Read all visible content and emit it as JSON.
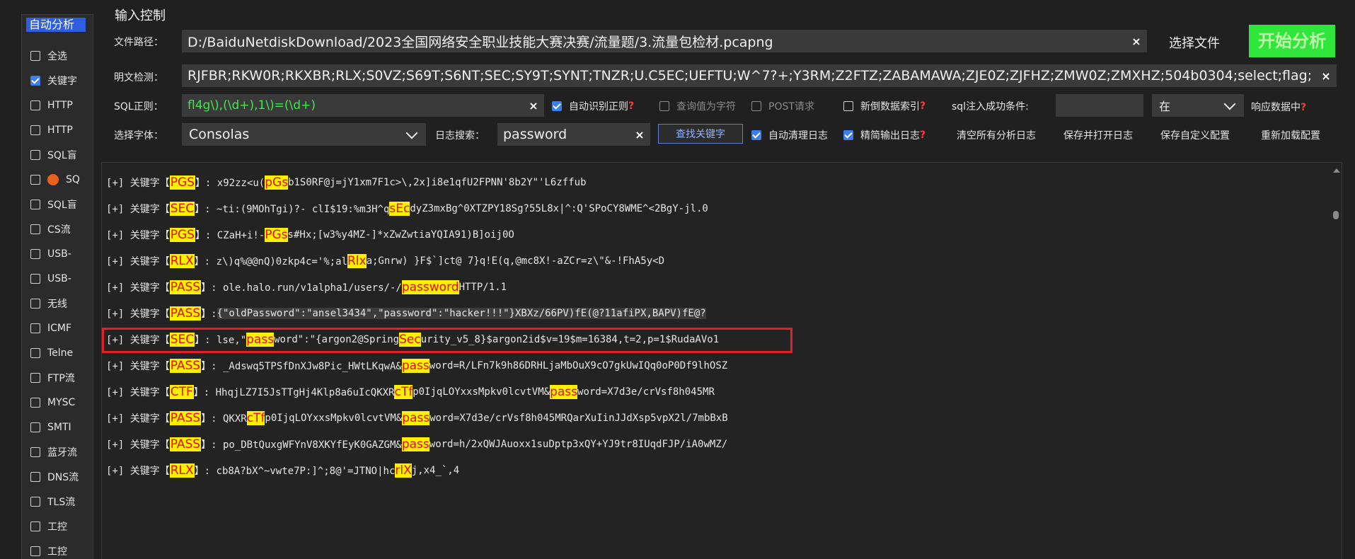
{
  "left_panel": {
    "header": "自动分析",
    "items": [
      {
        "label": "全选",
        "checked": false,
        "icon": null
      },
      {
        "label": "关键字",
        "checked": true,
        "icon": null
      },
      {
        "label": "HTTP",
        "checked": false,
        "icon": null
      },
      {
        "label": "HTTP",
        "checked": false,
        "icon": null
      },
      {
        "label": "SQL盲",
        "checked": false,
        "icon": null
      },
      {
        "label": "SQ",
        "checked": false,
        "icon": "orange-circle-icon"
      },
      {
        "label": "SQL盲",
        "checked": false,
        "icon": null
      },
      {
        "label": "CS流",
        "checked": false,
        "icon": null
      },
      {
        "label": "USB-",
        "checked": false,
        "icon": null
      },
      {
        "label": "USB-",
        "checked": false,
        "icon": null
      },
      {
        "label": "无线",
        "checked": false,
        "icon": null
      },
      {
        "label": "ICMF",
        "checked": false,
        "icon": null
      },
      {
        "label": "Telne",
        "checked": false,
        "icon": null
      },
      {
        "label": "FTP流",
        "checked": false,
        "icon": null
      },
      {
        "label": "MYSC",
        "checked": false,
        "icon": null
      },
      {
        "label": "SMTI",
        "checked": false,
        "icon": null
      },
      {
        "label": "蓝牙流",
        "checked": false,
        "icon": null
      },
      {
        "label": "DNS流",
        "checked": false,
        "icon": null
      },
      {
        "label": "TLS流",
        "checked": false,
        "icon": null
      },
      {
        "label": "工控",
        "checked": false,
        "icon": null
      },
      {
        "label": "工控",
        "checked": false,
        "icon": null
      }
    ]
  },
  "input_control": {
    "title": "输入控制",
    "file_path_label": "文件路径：",
    "file_path_value": "D:/BaiduNetdiskDownload/2023全国网络安全职业技能大赛决赛/流量题/3.流量包检材.pcapng",
    "select_file_label": "选择文件",
    "start_label": "开始分析",
    "plaintext_label": "明文检测：",
    "plaintext_value": ";RJFBR;RKW0R;RKXBR;RLX;S0VZ;S69T;S6NT;SEC;SY9T;SYNT;TNZR;U.C5EC;UEFTU;W^7?+;Y3RM;Z2FTZ;ZABAMAWA;ZJE0Z;ZJFHZ;ZMW0Z;ZMXHZ;504b0304;select;flag",
    "sql_regex_label": "SQL正则：",
    "sql_regex_value": "fl4g\\),(\\d+),1\\)=(\\d+)",
    "auto_regex_label": "自动识别正则",
    "query_as_char_label": "查询值为字符",
    "post_request_label": "POST请求",
    "new_index_label": "新倒数据索引",
    "sqli_success_label": "sql注入成功条件:",
    "sqli_success_value": "",
    "in_select_value": "在",
    "response_data_label": "响应数据中",
    "font_label": "选择字体：",
    "font_value": "Consolas",
    "log_search_label": "日志搜索：",
    "log_search_value": "password",
    "find_keyword_label": "查找关键字",
    "auto_clear_label": "自动清理日志",
    "simplified_output_label": "精简输出日志",
    "clear_all_label": "清空所有分析日志",
    "save_open_label": "保存并打开日志",
    "save_config_label": "保存自定义配置",
    "reload_config_label": "重新加载配置",
    "question_mark": "?",
    "close_x": "×"
  },
  "colors": {
    "accent_blue": "#2f5fe0",
    "start_green": "#31e63a",
    "highlight_yellow": "#ffef00",
    "highlight_red": "#e21010",
    "selection_red": "#e0202a"
  },
  "log_lines": [
    {
      "segs": [
        {
          "t": "[+] 关键字【"
        },
        {
          "t": "PGS",
          "k": 1
        },
        {
          "t": "】: x92zz<u("
        },
        {
          "t": "pGs",
          "h": 1
        },
        {
          "t": "b1S0RF@j=jY1xm7F1c>\\,2x]i8e1qfU2FPNN'8b2Y\"'L6zffub"
        }
      ]
    },
    {
      "segs": [
        {
          "t": "[+] 关键字【"
        },
        {
          "t": "SEC",
          "k": 1
        },
        {
          "t": "】: ~ti:(9MOhTgi)?- clI$19:%m3H^q"
        },
        {
          "t": "sEc",
          "h": 1
        },
        {
          "t": "dyZ3mxBg^0XTZPY18Sg?55L8x|^:Q'SPoCY8WME^<2BgY-jl.0"
        }
      ]
    },
    {
      "segs": [
        {
          "t": "[+] 关键字【"
        },
        {
          "t": "PGS",
          "k": 1
        },
        {
          "t": "】: CZaH+i!-"
        },
        {
          "t": "PGs",
          "h": 1
        },
        {
          "t": "s#Hx;[w3%y4MZ-]*xZwZwtiaYQIA91)B]oij0O"
        }
      ]
    },
    {
      "segs": [
        {
          "t": "[+] 关键字【"
        },
        {
          "t": "RLX",
          "k": 1
        },
        {
          "t": "】: z\\)q%@@nQ)0zkp4c='%;al"
        },
        {
          "t": "Rlx",
          "h": 1
        },
        {
          "t": "a;Gnrw) }F$`]ct@ 7}q!E(q,@mc8X!-aZCr=z\\\"&-!FhA5y<D"
        }
      ]
    },
    {
      "segs": [
        {
          "t": "[+] 关键字【"
        },
        {
          "t": "PASS",
          "k": 1
        },
        {
          "t": "】: ole.halo.run/v1alpha1/users/-/"
        },
        {
          "t": "pass",
          "h": 1
        },
        {
          "t": "word",
          "h": 1
        },
        {
          "t": " HTTP/1.1"
        }
      ]
    },
    {
      "sel": true,
      "segs": [
        {
          "t": "[+] 关键字【"
        },
        {
          "t": "PASS",
          "k": 1
        },
        {
          "t": "】: "
        },
        {
          "t": "{\"oldPassword\":\"ansel3434\",\"password\":\"hacker!!!\"}XBXz/66PV)fE(@?11afiPX,BAPV)fE@?",
          "s": 1
        }
      ]
    },
    {
      "segs": [
        {
          "t": "[+] 关键字【"
        },
        {
          "t": "SEC",
          "k": 1
        },
        {
          "t": "】: lse,\""
        },
        {
          "t": "pass",
          "h": 1
        },
        {
          "t": "word\":\"{argon2@Spring"
        },
        {
          "t": "Sec",
          "h": 1
        },
        {
          "t": "urity_v5_8}$argon2id$v=19$m=16384,t=2,p=1$RudaAVo1"
        }
      ]
    },
    {
      "segs": [
        {
          "t": "[+] 关键字【"
        },
        {
          "t": "PASS",
          "k": 1
        },
        {
          "t": "】: _Adswq5TPSfDnXJw8Pic_HWtLKqwA&"
        },
        {
          "t": "pass",
          "h": 1
        },
        {
          "t": "word=R/LFn7k9h86DRHLjaMbOuX9cO7gkUwIQq0oP0Df9lhOSZ"
        }
      ]
    },
    {
      "segs": [
        {
          "t": "[+] 关键字【"
        },
        {
          "t": "CTF",
          "k": 1
        },
        {
          "t": "】: HhqjLZ7I5JsTTgHj4Klp8a6uIcQKXR"
        },
        {
          "t": "cTf",
          "h": 1
        },
        {
          "t": "p0IjqLOYxxsMpkv0lcvtVM&"
        },
        {
          "t": "pass",
          "h": 1
        },
        {
          "t": "word=X7d3e/crVsf8h045MR"
        }
      ]
    },
    {
      "segs": [
        {
          "t": "[+] 关键字【"
        },
        {
          "t": "PASS",
          "k": 1
        },
        {
          "t": "】: QKXR"
        },
        {
          "t": "cTf",
          "h": 1
        },
        {
          "t": "p0IjqLOYxxsMpkv0lcvtVM&"
        },
        {
          "t": "pass",
          "h": 1
        },
        {
          "t": "word=X7d3e/crVsf8h045MRQarXuIinJJdXsp5vpX2l/7mbBxB"
        }
      ]
    },
    {
      "segs": [
        {
          "t": "[+] 关键字【"
        },
        {
          "t": "PASS",
          "k": 1
        },
        {
          "t": "】: po_DBtQuxgWFYnV8XKYfEyK0GAZGM&"
        },
        {
          "t": "pass",
          "h": 1
        },
        {
          "t": "word=h/2xQWJAuoxx1suDptp3xQY+YJ9tr8IUqdFJP/iA0wMZ/"
        }
      ]
    },
    {
      "segs": [
        {
          "t": "[+] 关键字【"
        },
        {
          "t": "RLX",
          "k": 1
        },
        {
          "t": "】: cb8A?bX^~vwte7P:]^;8@'=JTNO|hc"
        },
        {
          "t": "rlX",
          "h": 1
        },
        {
          "t": "j,x4_`,4"
        }
      ]
    }
  ]
}
